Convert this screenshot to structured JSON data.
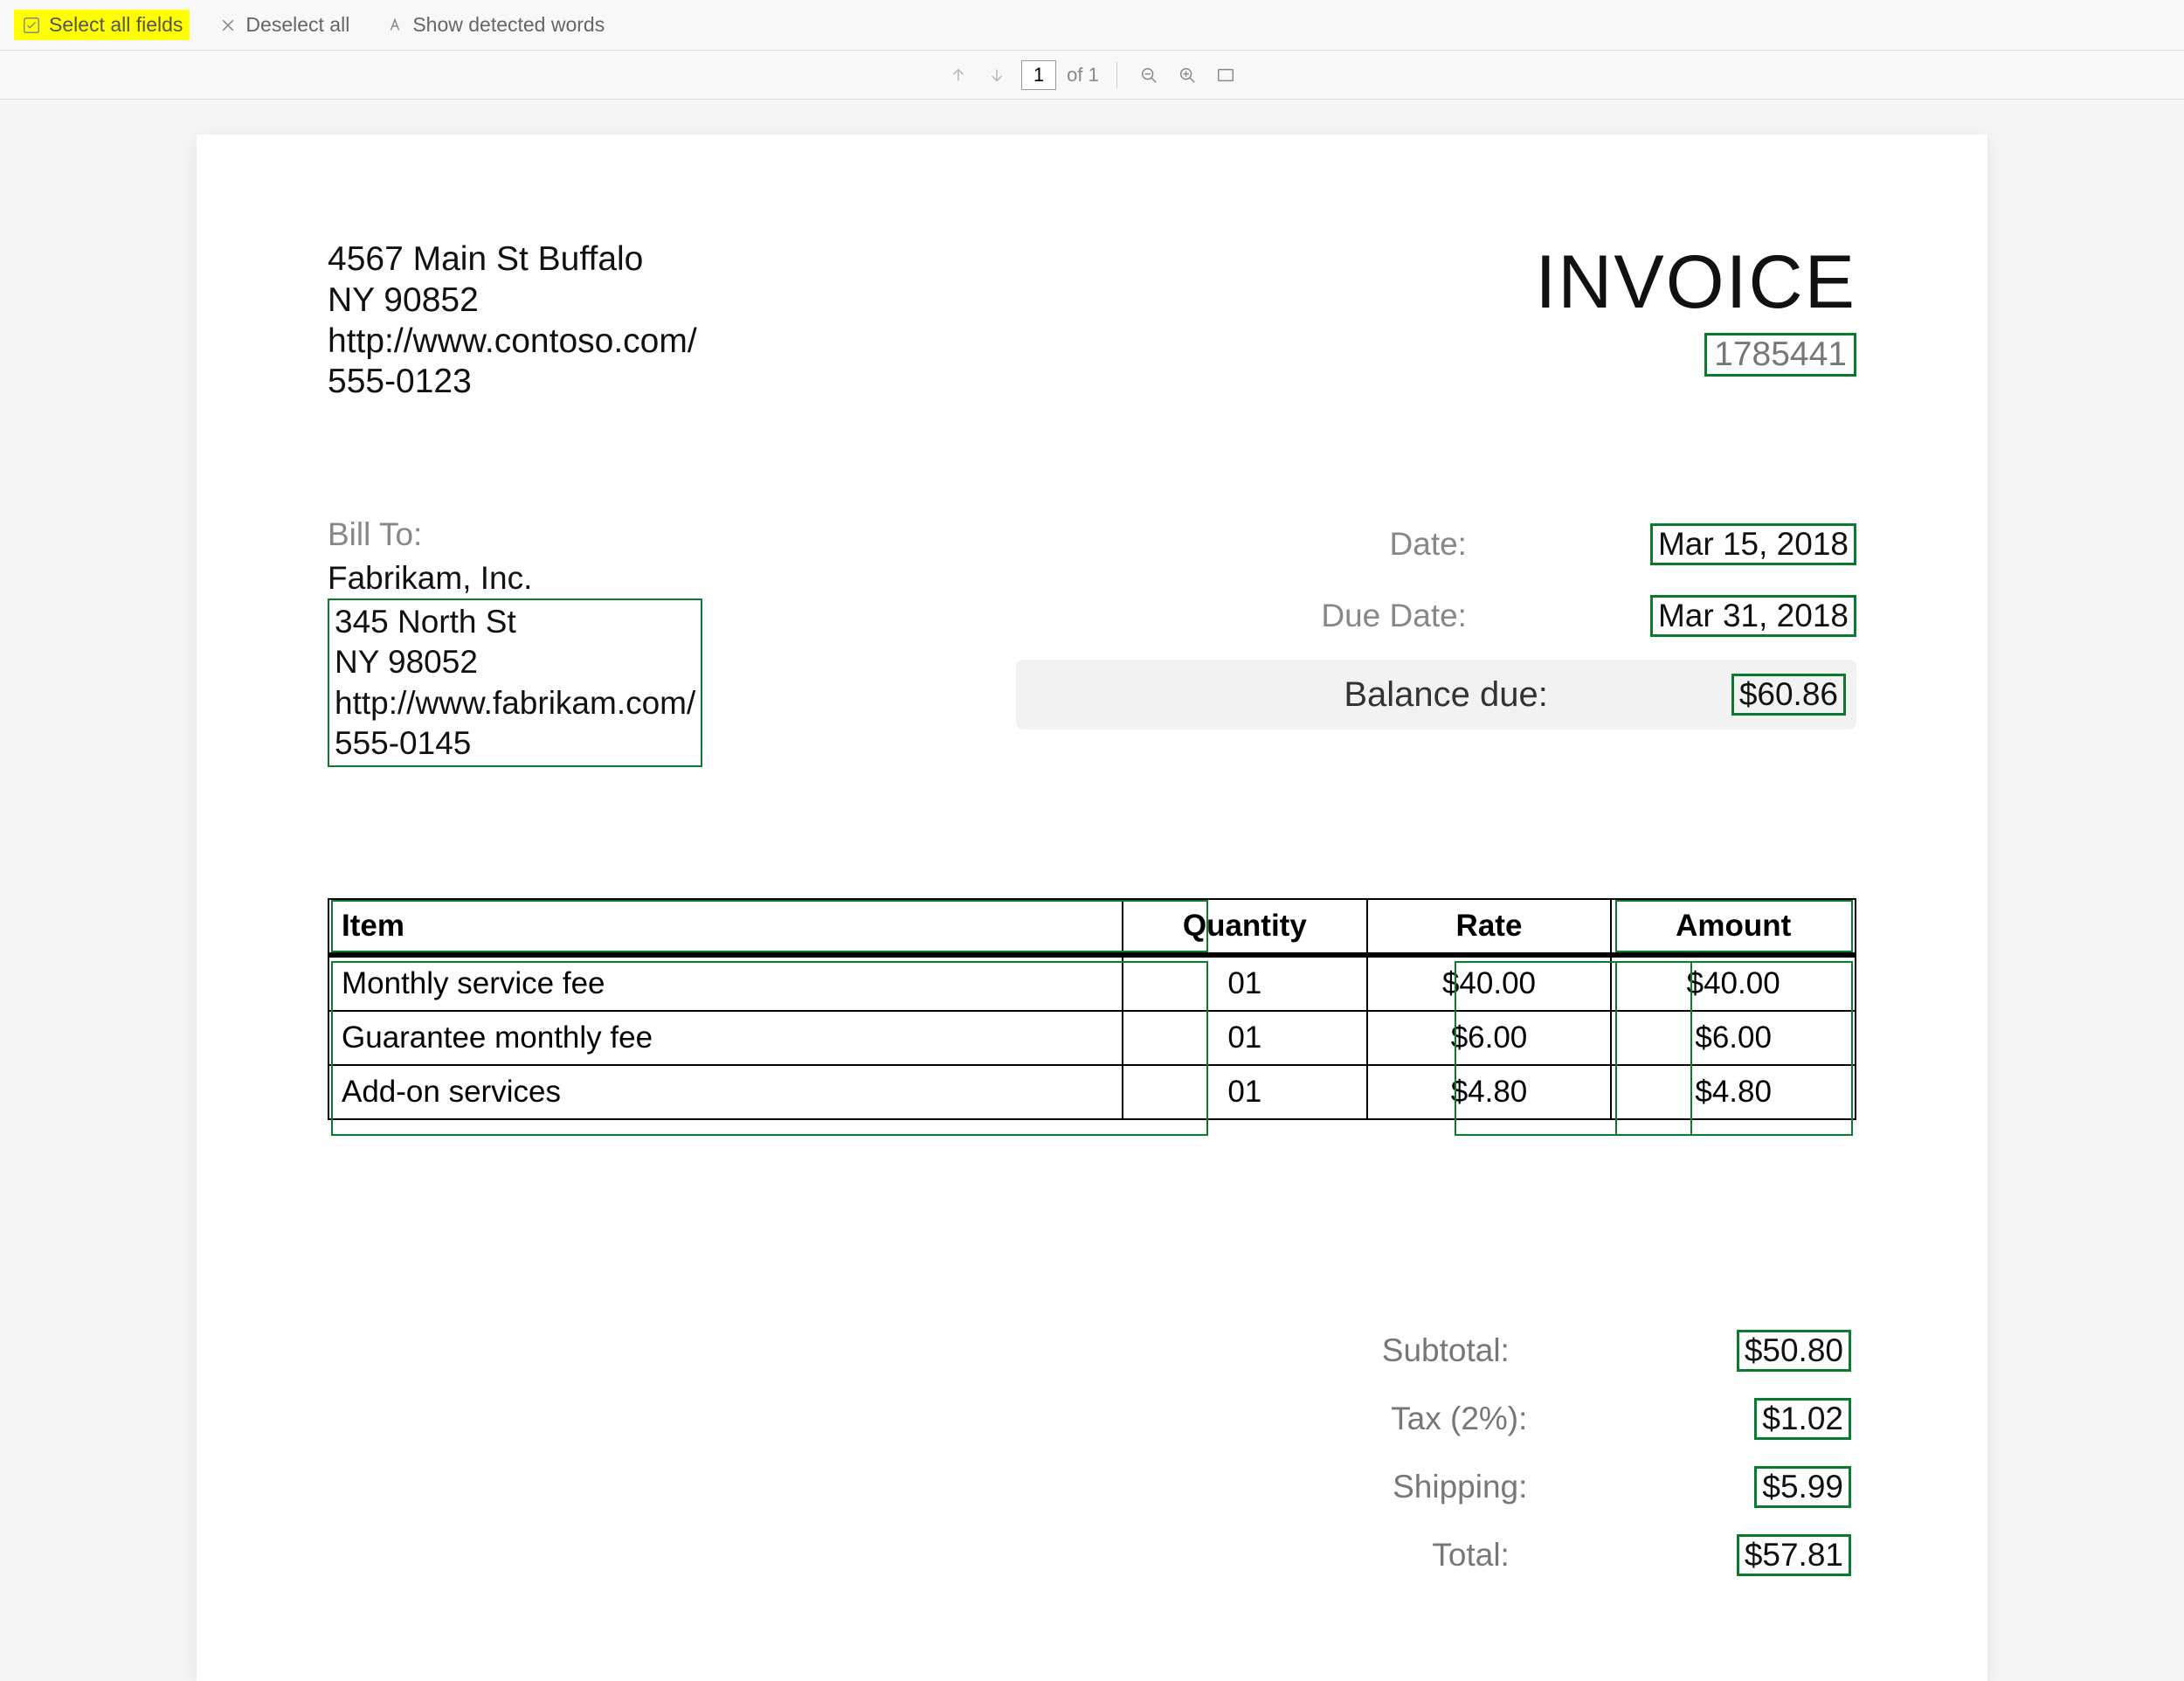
{
  "toolbar": {
    "select_all": "Select all fields",
    "deselect_all": "Deselect all",
    "show_words": "Show detected words"
  },
  "pager": {
    "page": "1",
    "of_label": "of 1"
  },
  "from": {
    "l1": "4567 Main St Buffalo",
    "l2": "NY 90852",
    "l3": "http://www.contoso.com/",
    "l4": "555-0123"
  },
  "invoice": {
    "title": "INVOICE",
    "number": "1785441"
  },
  "dates": {
    "date_label": "Date:",
    "date_value": "Mar 15, 2018",
    "due_label": "Due Date:",
    "due_value": "Mar 31, 2018",
    "balance_label": "Balance due:",
    "balance_value": "$60.86"
  },
  "billto": {
    "label": "Bill To:",
    "name": "Fabrikam, Inc.",
    "l1": "345 North St",
    "l2": "NY 98052",
    "l3": "http://www.fabrikam.com/",
    "l4": "555-0145"
  },
  "table": {
    "headers": [
      "Item",
      "Quantity",
      "Rate",
      "Amount"
    ],
    "rows": [
      {
        "item": "Monthly service fee",
        "qty": "01",
        "rate": "$40.00",
        "amount": "$40.00"
      },
      {
        "item": "Guarantee monthly fee",
        "qty": "01",
        "rate": "$6.00",
        "amount": "$6.00"
      },
      {
        "item": "Add-on services",
        "qty": "01",
        "rate": "$4.80",
        "amount": "$4.80"
      }
    ]
  },
  "totals": {
    "subtotal_label": "Subtotal:",
    "subtotal_value": "$50.80",
    "tax_label": "Tax (2%):",
    "tax_value": "$1.02",
    "shipping_label": "Shipping:",
    "shipping_value": "$5.99",
    "total_label": "Total:",
    "total_value": "$57.81"
  }
}
